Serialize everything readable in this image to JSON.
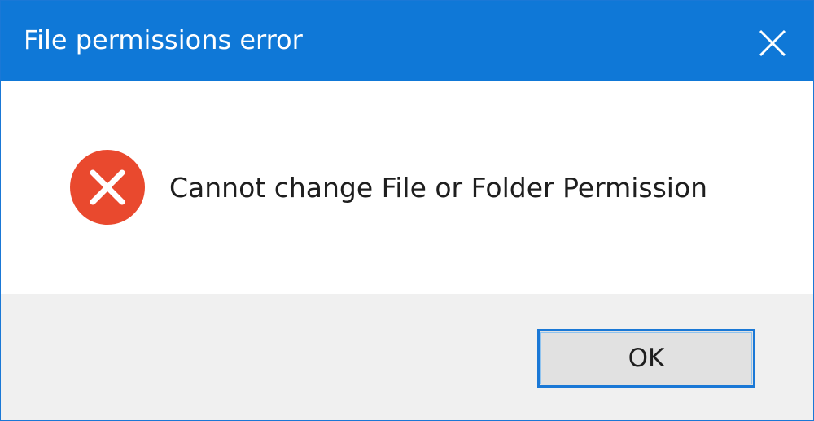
{
  "window": {
    "title": "File permissions error",
    "close_icon": "close-icon",
    "accent_color": "#0F78D7"
  },
  "content": {
    "icon": "error-icon",
    "icon_color": "#E9492E",
    "message": "Cannot change File or Folder Permission"
  },
  "footer": {
    "ok_label": "OK"
  }
}
